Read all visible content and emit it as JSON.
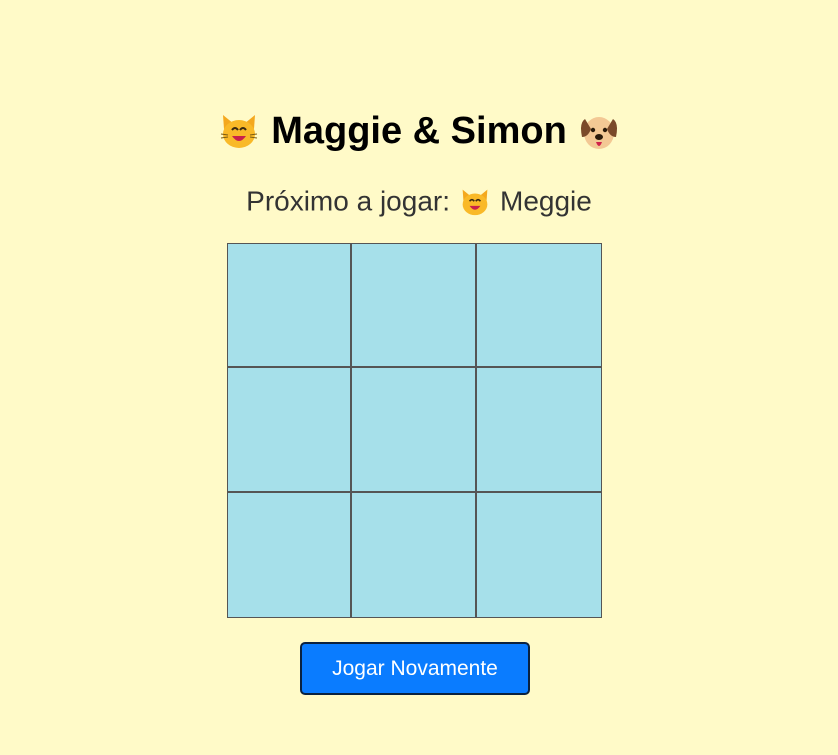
{
  "header": {
    "title": "Maggie & Simon",
    "left_icon": "cat-face-icon",
    "right_icon": "dog-face-icon"
  },
  "status": {
    "label": "Próximo a jogar:",
    "player_icon": "cat-face-icon",
    "player_name": "Meggie"
  },
  "board": {
    "cells": [
      "",
      "",
      "",
      "",
      "",
      "",
      "",
      "",
      ""
    ]
  },
  "actions": {
    "play_again_label": "Jogar Novamente"
  },
  "colors": {
    "background": "#fffac8",
    "cell": "#a6e0ea",
    "grid_line": "#555555",
    "button": "#0a7cff"
  }
}
